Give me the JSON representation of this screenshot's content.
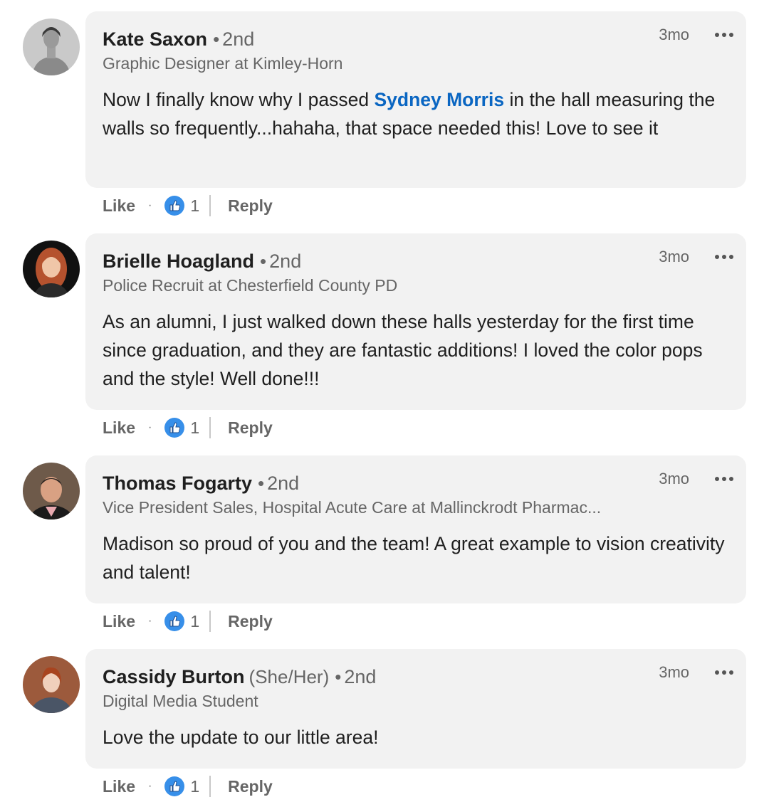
{
  "comments": [
    {
      "name": "Kate Saxon",
      "pronouns": "",
      "degree": "2nd",
      "headline": "Graphic Designer at Kimley-Horn",
      "time": "3mo",
      "body_before": "Now I finally know why I passed ",
      "mention": "Sydney Morris",
      "body_after": " in the hall measuring the walls so frequently...hahaha, that space needed this! Love to see it",
      "like_label": "Like",
      "reaction_count": "1",
      "reply_label": "Reply"
    },
    {
      "name": "Brielle Hoagland",
      "pronouns": "",
      "degree": "2nd",
      "headline": "Police Recruit at Chesterfield County PD",
      "time": "3mo",
      "body_before": "As an alumni, I just walked down these halls yesterday for the first time since graduation, and they are fantastic additions! I loved the color pops and the style! Well done!!!",
      "mention": "",
      "body_after": "",
      "like_label": "Like",
      "reaction_count": "1",
      "reply_label": "Reply"
    },
    {
      "name": "Thomas Fogarty",
      "pronouns": "",
      "degree": "2nd",
      "headline": "Vice President Sales, Hospital Acute Care at Mallinckrodt Pharmac...",
      "time": "3mo",
      "body_before": "Madison so proud of you and the team! A great example to vision creativity and talent!",
      "mention": "",
      "body_after": "",
      "like_label": "Like",
      "reaction_count": "1",
      "reply_label": "Reply"
    },
    {
      "name": "Cassidy Burton",
      "pronouns": "(She/Her)",
      "degree": "2nd",
      "headline": "Digital Media Student",
      "time": "3mo",
      "body_before": "Love the update to our little area!",
      "mention": "",
      "body_after": "",
      "like_label": "Like",
      "reaction_count": "1",
      "reply_label": "Reply"
    }
  ],
  "icons": {
    "reaction": "like-reaction-icon",
    "more": "more-options-icon"
  },
  "colors": {
    "mention": "#0a66c2",
    "bubble": "#f2f2f2",
    "reaction": "#378fe9"
  }
}
